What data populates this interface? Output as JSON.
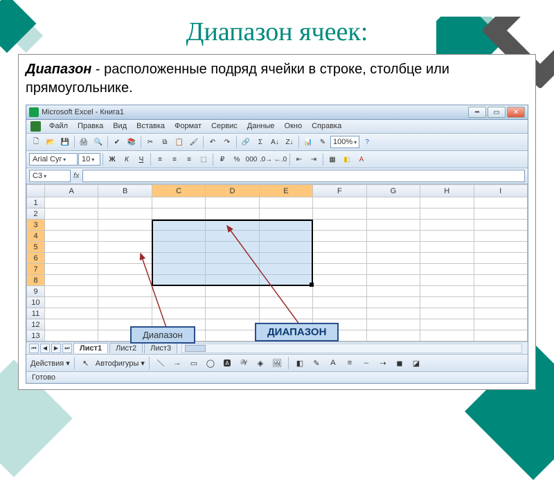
{
  "slide": {
    "title": "Диапазон ячеек:",
    "definition_term": "Диапазон",
    "definition_rest": " - расположенные подряд ячейки в строке, столбце или прямоугольнике."
  },
  "excel": {
    "titlebar": "Microsoft Excel - Книга1",
    "menus": [
      "Файл",
      "Правка",
      "Вид",
      "Вставка",
      "Формат",
      "Сервис",
      "Данные",
      "Окно",
      "Справка"
    ],
    "zoom": "100%",
    "font_name": "Arial Cyr",
    "font_size": "10",
    "namebox": "C3",
    "columns": [
      "",
      "A",
      "B",
      "C",
      "D",
      "E",
      "F",
      "G",
      "H",
      "I"
    ],
    "rows": [
      "1",
      "2",
      "3",
      "4",
      "5",
      "6",
      "7",
      "8",
      "9",
      "10",
      "11",
      "12",
      "13"
    ],
    "selected_cols": [
      "C",
      "D",
      "E"
    ],
    "selected_rows_from": 3,
    "selected_rows_to": 8,
    "sheets": [
      "Лист1",
      "Лист2",
      "Лист3"
    ],
    "active_sheet": 0,
    "draw_label": "Действия",
    "autoshapes": "Автофигуры",
    "status": "Готово"
  },
  "callouts": {
    "label1": "Диапазон",
    "label2": "ДИАПАЗОН"
  }
}
